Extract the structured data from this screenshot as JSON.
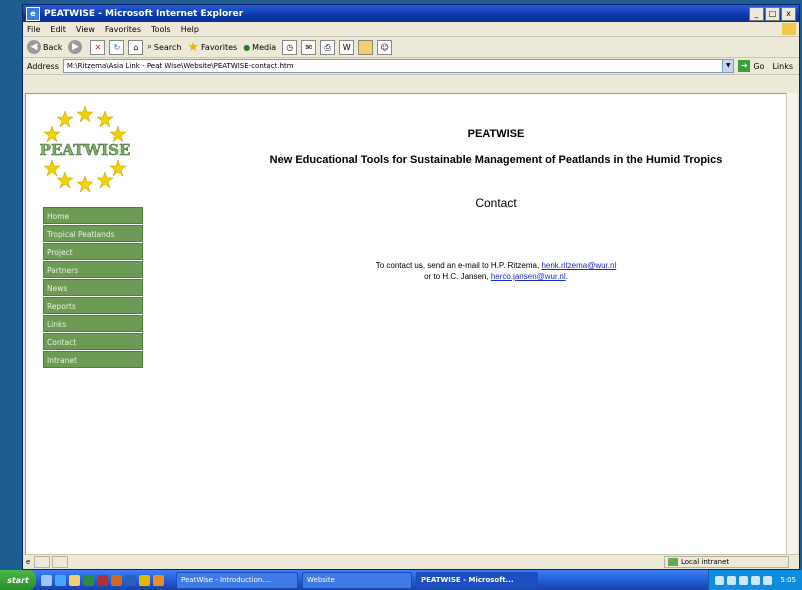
{
  "window": {
    "title": "PEATWISE - Microsoft Internet Explorer",
    "min": "_",
    "max": "□",
    "close": "x"
  },
  "menu": [
    "File",
    "Edit",
    "View",
    "Favorites",
    "Tools",
    "Help"
  ],
  "toolbar": {
    "back": "Back",
    "search": "Search",
    "favorites": "Favorites",
    "media": "Media"
  },
  "address": {
    "label": "Address",
    "url": "M:\\Ritzema\\Asia Link - Peat Wise\\Website\\PEATWISE-contact.htm",
    "go": "Go",
    "links": "Links"
  },
  "logo": {
    "text": "PEATWISE"
  },
  "nav": [
    "Home",
    "Tropical Peatlands",
    "Project",
    "Partners",
    "News",
    "Reports",
    "Links",
    "Contact",
    "Intranet"
  ],
  "page": {
    "site_title": "PEATWISE",
    "tagline": "New Educational Tools for Sustainable Management of Peatlands in the Humid Tropics",
    "heading": "Contact",
    "line1_prefix": "To contact us, send an e-mail to H.P. Ritzema,",
    "email1": "henk.ritzema@wur.nl",
    "line2_prefix": "or to H.C. Jansen,",
    "email2": "herco.jansen@wur.nl",
    "line2_suffix": "."
  },
  "status": {
    "zone": "Local intranet"
  },
  "taskbar": {
    "start": "start",
    "tasks": [
      "PeatWise - Introduction....",
      "Website",
      "PEATWISE - Microsoft..."
    ],
    "clock": "5:05"
  }
}
